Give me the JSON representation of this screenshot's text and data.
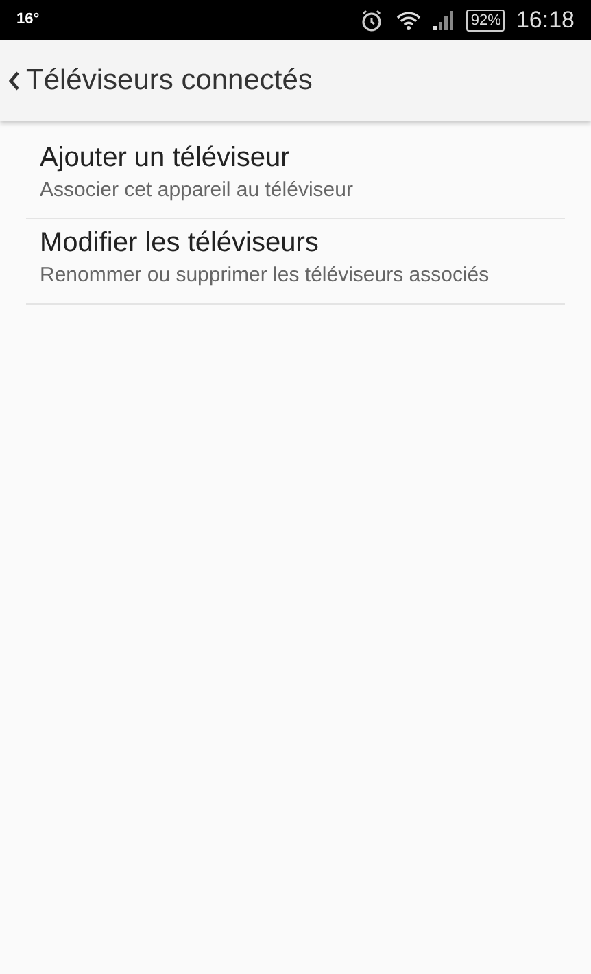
{
  "status_bar": {
    "temperature": "16°",
    "battery": "92%",
    "time": "16:18"
  },
  "header": {
    "title": "Téléviseurs connectés"
  },
  "items": [
    {
      "title": "Ajouter un téléviseur",
      "description": "Associer cet appareil au téléviseur"
    },
    {
      "title": "Modifier les téléviseurs",
      "description": "Renommer ou supprimer les téléviseurs associés"
    }
  ]
}
